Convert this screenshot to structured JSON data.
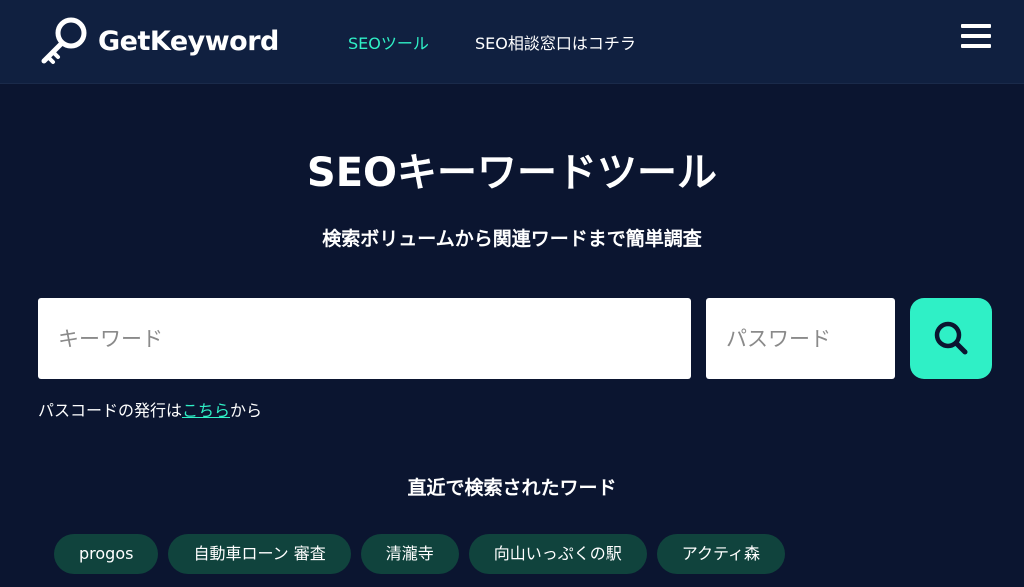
{
  "header": {
    "brand_name": "GetKeyword",
    "nav": [
      {
        "label": "SEOツール",
        "active": true
      },
      {
        "label": "SEO相談窓口はコチラ",
        "active": false
      }
    ],
    "menu_icon": "hamburger-menu-icon",
    "brand_icon": "key-icon"
  },
  "hero": {
    "title": "SEOキーワードツール",
    "subtitle": "検索ボリュームから関連ワードまで簡単調査"
  },
  "search": {
    "keyword_placeholder": "キーワード",
    "keyword_value": "",
    "password_placeholder": "パスワード",
    "password_value": "",
    "button_icon": "search-icon"
  },
  "passcode_note": {
    "prefix": "パスコードの発行は",
    "link": "こちら",
    "suffix": "から"
  },
  "recent": {
    "heading": "直近で検索されたワード",
    "tags": [
      "progos",
      "自動車ローン 審査",
      "清瀧寺",
      "向山いっぷくの駅",
      "アクティ森"
    ]
  },
  "colors": {
    "background": "#0b1530",
    "header_background": "#102040",
    "accent": "#2ff0c6",
    "tag_background": "#10433d"
  }
}
